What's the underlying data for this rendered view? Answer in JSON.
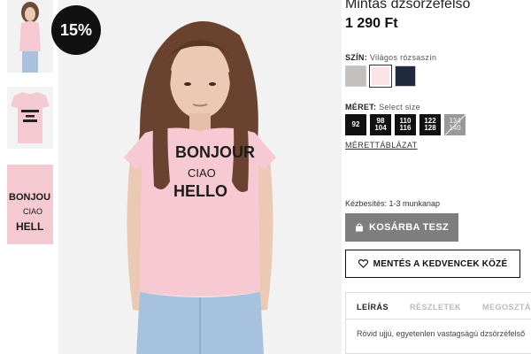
{
  "discount_badge": "15%",
  "product": {
    "title": "Mintás dzsörzéfelső",
    "price": "1 290 Ft"
  },
  "color": {
    "label": "SZÍN:",
    "value": "Világos rózsaszín",
    "swatches": [
      {
        "name": "grey",
        "hex": "#c3bfbd",
        "selected": false
      },
      {
        "name": "light-pink",
        "hex": "#fbe3e7",
        "selected": true
      },
      {
        "name": "navy",
        "hex": "#1f2b3d",
        "selected": false
      }
    ]
  },
  "size": {
    "label": "MÉRET:",
    "value": "Select size",
    "options": [
      {
        "top": "92",
        "bottom": "",
        "available": true
      },
      {
        "top": "98",
        "bottom": "104",
        "available": true
      },
      {
        "top": "110",
        "bottom": "116",
        "available": true
      },
      {
        "top": "122",
        "bottom": "128",
        "available": true
      },
      {
        "top": "134",
        "bottom": "140",
        "available": false
      }
    ]
  },
  "size_guide_link": "MÉRETTÁBLÁZAT",
  "delivery_text": "Kézbesítés: 1-3 munkanap",
  "add_to_cart_label": "KOSÁRBA TESZ",
  "favorite_label": "MENTÉS A KEDVENCEK KÖZÉ",
  "tabs": [
    {
      "label": "LEÍRÁS",
      "active": true
    },
    {
      "label": "RÉSZLETEK",
      "active": false
    },
    {
      "label": "MEGOSZTÁ",
      "active": false
    }
  ],
  "description_text": "Rövid ujjú, egyetenlen vastagságú dzsörzéfelső",
  "shirt_print": [
    "BONJOUR",
    "CIAO",
    "HELLO"
  ],
  "icons": {
    "cart": "shopping-bag-icon",
    "favorite": "heart-icon"
  }
}
